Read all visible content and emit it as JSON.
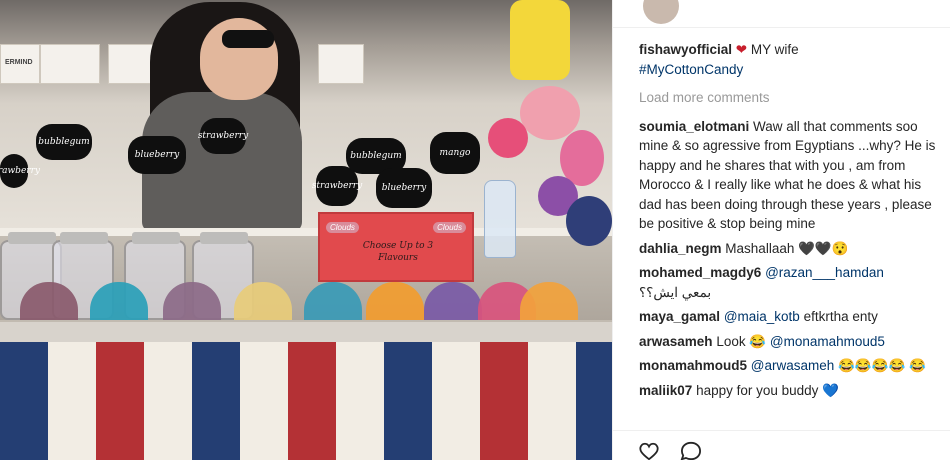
{
  "caption": {
    "username": "fishawyofficial",
    "heart": "❤",
    "text": "MY wife",
    "hashtag": "#MyCottonCandy"
  },
  "load_more_label": "Load more comments",
  "comments": [
    {
      "username": "soumia_elotmani",
      "text": "Waw all that comments soo mine & so agressive from Egyptians ...why? He is happy and he shares that with you , am from Morocco & I really like what he does & what his dad has been doing through these years , please be positive & stop being mine"
    },
    {
      "username": "dahlia_negm",
      "text": "Mashallaah 🖤🖤😯"
    },
    {
      "username": "mohamed_magdy6",
      "mention": "@razan___hamdan",
      "text2": "بمعي ايش؟؟"
    },
    {
      "username": "maya_gamal",
      "mention": "@maia_kotb",
      "text": "eftkrtha enty"
    },
    {
      "username": "arwasameh",
      "text": "Look 😂",
      "mention": "@monamahmoud5"
    },
    {
      "username": "monamahmoud5",
      "mention": "@arwasameh",
      "text": "😂😂😂😂 😂"
    },
    {
      "username": "maliik07",
      "text": "happy for you buddy 💙"
    }
  ],
  "photo": {
    "signs": [
      "bubblegum",
      "strawberry",
      "blueberry",
      "bubblegum",
      "mango",
      "strawberry",
      "blueberry",
      "Strawberry"
    ],
    "board_text": "Choose Up to 3 Flavours",
    "board_title_left": "Clouds",
    "board_title_right": "Clouds",
    "mall_sign": "ERMIND"
  },
  "icons": {
    "like": "heart-outline-icon",
    "comment": "speech-bubble-icon"
  }
}
